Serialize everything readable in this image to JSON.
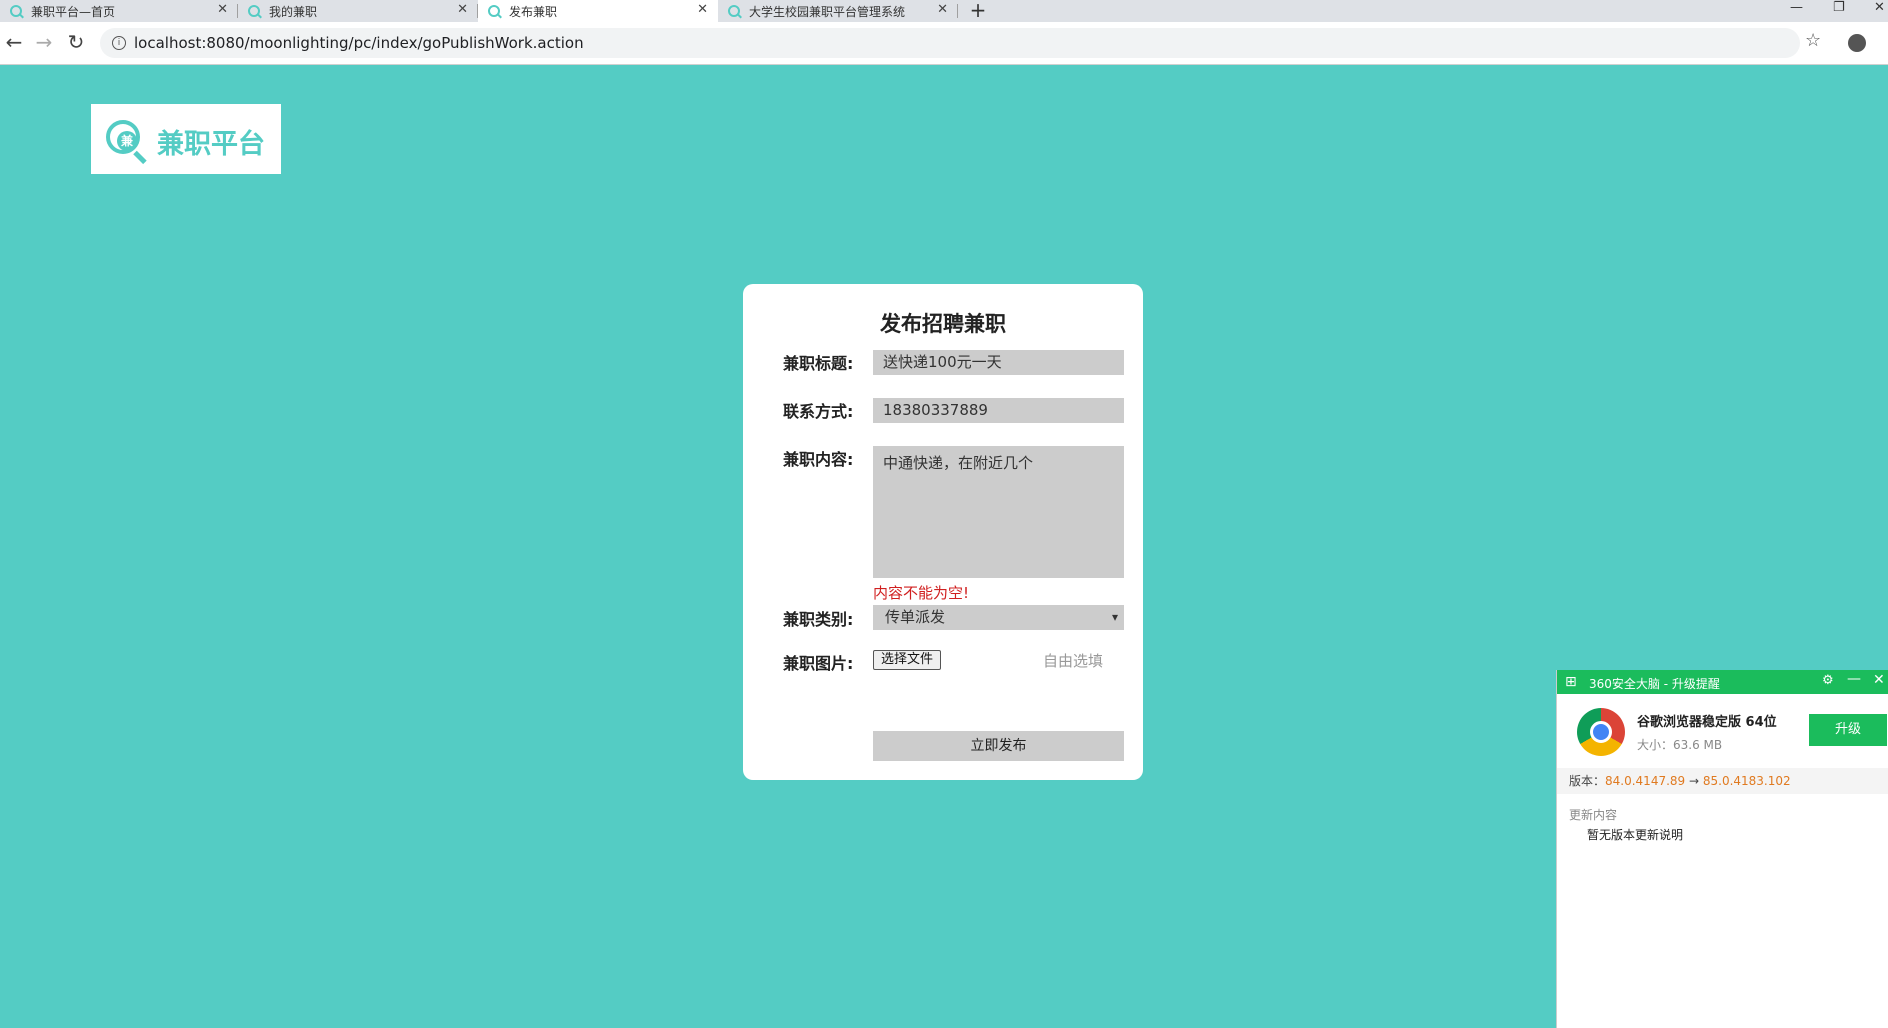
{
  "browser": {
    "tabs": [
      {
        "title": "兼职平台—首页",
        "close": "✕"
      },
      {
        "title": "我的兼职",
        "close": "✕"
      },
      {
        "title": "发布兼职",
        "close": "✕"
      },
      {
        "title": "大学生校园兼职平台管理系统",
        "close": "✕"
      }
    ],
    "new_tab": "+",
    "minimize": "—",
    "restore": "❐",
    "close_window": "✕",
    "back": "←",
    "forward": "→",
    "reload": "↻",
    "info": "i",
    "url": "localhost:8080/moonlighting/pc/index/goPublishWork.action",
    "star": "☆"
  },
  "logo": {
    "glyph": "兼",
    "text": "兼职平台"
  },
  "form": {
    "title": "发布招聘兼职",
    "title_label": "兼职标题:",
    "title_value": "送快递100元一天",
    "contact_label": "联系方式:",
    "contact_value": "18380337889",
    "content_label": "兼职内容:",
    "content_value": "中通快递，在附近几个",
    "content_error": "内容不能为空!",
    "category_label": "兼职类别:",
    "category_value": "传单派发",
    "image_label": "兼职图片:",
    "file_button": "选择文件",
    "optional_hint": "自由选填",
    "submit": "立即发布"
  },
  "popup": {
    "header_icon": "⊞",
    "header_title": "360安全大脑 - 升级提醒",
    "settings": "⚙",
    "minimize": "—",
    "close": "✕",
    "product_name": "谷歌浏览器稳定版 64位",
    "size": "大小：63.6 MB",
    "upgrade": "升级",
    "version_label": "版本：",
    "version_from": "84.0.4147.89",
    "arrow": " → ",
    "version_to": "85.0.4183.102",
    "notes_header": "更新内容",
    "notes": "暂无版本更新说明"
  }
}
